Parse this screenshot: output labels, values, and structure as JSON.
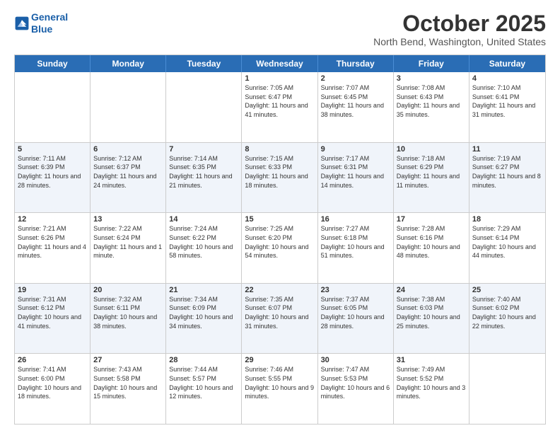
{
  "logo": {
    "line1": "General",
    "line2": "Blue"
  },
  "header": {
    "month": "October 2025",
    "location": "North Bend, Washington, United States"
  },
  "day_headers": [
    "Sunday",
    "Monday",
    "Tuesday",
    "Wednesday",
    "Thursday",
    "Friday",
    "Saturday"
  ],
  "weeks": [
    [
      {
        "date": "",
        "sunrise": "",
        "sunset": "",
        "daylight": ""
      },
      {
        "date": "",
        "sunrise": "",
        "sunset": "",
        "daylight": ""
      },
      {
        "date": "",
        "sunrise": "",
        "sunset": "",
        "daylight": ""
      },
      {
        "date": "1",
        "sunrise": "Sunrise: 7:05 AM",
        "sunset": "Sunset: 6:47 PM",
        "daylight": "Daylight: 11 hours and 41 minutes."
      },
      {
        "date": "2",
        "sunrise": "Sunrise: 7:07 AM",
        "sunset": "Sunset: 6:45 PM",
        "daylight": "Daylight: 11 hours and 38 minutes."
      },
      {
        "date": "3",
        "sunrise": "Sunrise: 7:08 AM",
        "sunset": "Sunset: 6:43 PM",
        "daylight": "Daylight: 11 hours and 35 minutes."
      },
      {
        "date": "4",
        "sunrise": "Sunrise: 7:10 AM",
        "sunset": "Sunset: 6:41 PM",
        "daylight": "Daylight: 11 hours and 31 minutes."
      }
    ],
    [
      {
        "date": "5",
        "sunrise": "Sunrise: 7:11 AM",
        "sunset": "Sunset: 6:39 PM",
        "daylight": "Daylight: 11 hours and 28 minutes."
      },
      {
        "date": "6",
        "sunrise": "Sunrise: 7:12 AM",
        "sunset": "Sunset: 6:37 PM",
        "daylight": "Daylight: 11 hours and 24 minutes."
      },
      {
        "date": "7",
        "sunrise": "Sunrise: 7:14 AM",
        "sunset": "Sunset: 6:35 PM",
        "daylight": "Daylight: 11 hours and 21 minutes."
      },
      {
        "date": "8",
        "sunrise": "Sunrise: 7:15 AM",
        "sunset": "Sunset: 6:33 PM",
        "daylight": "Daylight: 11 hours and 18 minutes."
      },
      {
        "date": "9",
        "sunrise": "Sunrise: 7:17 AM",
        "sunset": "Sunset: 6:31 PM",
        "daylight": "Daylight: 11 hours and 14 minutes."
      },
      {
        "date": "10",
        "sunrise": "Sunrise: 7:18 AM",
        "sunset": "Sunset: 6:29 PM",
        "daylight": "Daylight: 11 hours and 11 minutes."
      },
      {
        "date": "11",
        "sunrise": "Sunrise: 7:19 AM",
        "sunset": "Sunset: 6:27 PM",
        "daylight": "Daylight: 11 hours and 8 minutes."
      }
    ],
    [
      {
        "date": "12",
        "sunrise": "Sunrise: 7:21 AM",
        "sunset": "Sunset: 6:26 PM",
        "daylight": "Daylight: 11 hours and 4 minutes."
      },
      {
        "date": "13",
        "sunrise": "Sunrise: 7:22 AM",
        "sunset": "Sunset: 6:24 PM",
        "daylight": "Daylight: 11 hours and 1 minute."
      },
      {
        "date": "14",
        "sunrise": "Sunrise: 7:24 AM",
        "sunset": "Sunset: 6:22 PM",
        "daylight": "Daylight: 10 hours and 58 minutes."
      },
      {
        "date": "15",
        "sunrise": "Sunrise: 7:25 AM",
        "sunset": "Sunset: 6:20 PM",
        "daylight": "Daylight: 10 hours and 54 minutes."
      },
      {
        "date": "16",
        "sunrise": "Sunrise: 7:27 AM",
        "sunset": "Sunset: 6:18 PM",
        "daylight": "Daylight: 10 hours and 51 minutes."
      },
      {
        "date": "17",
        "sunrise": "Sunrise: 7:28 AM",
        "sunset": "Sunset: 6:16 PM",
        "daylight": "Daylight: 10 hours and 48 minutes."
      },
      {
        "date": "18",
        "sunrise": "Sunrise: 7:29 AM",
        "sunset": "Sunset: 6:14 PM",
        "daylight": "Daylight: 10 hours and 44 minutes."
      }
    ],
    [
      {
        "date": "19",
        "sunrise": "Sunrise: 7:31 AM",
        "sunset": "Sunset: 6:12 PM",
        "daylight": "Daylight: 10 hours and 41 minutes."
      },
      {
        "date": "20",
        "sunrise": "Sunrise: 7:32 AM",
        "sunset": "Sunset: 6:11 PM",
        "daylight": "Daylight: 10 hours and 38 minutes."
      },
      {
        "date": "21",
        "sunrise": "Sunrise: 7:34 AM",
        "sunset": "Sunset: 6:09 PM",
        "daylight": "Daylight: 10 hours and 34 minutes."
      },
      {
        "date": "22",
        "sunrise": "Sunrise: 7:35 AM",
        "sunset": "Sunset: 6:07 PM",
        "daylight": "Daylight: 10 hours and 31 minutes."
      },
      {
        "date": "23",
        "sunrise": "Sunrise: 7:37 AM",
        "sunset": "Sunset: 6:05 PM",
        "daylight": "Daylight: 10 hours and 28 minutes."
      },
      {
        "date": "24",
        "sunrise": "Sunrise: 7:38 AM",
        "sunset": "Sunset: 6:03 PM",
        "daylight": "Daylight: 10 hours and 25 minutes."
      },
      {
        "date": "25",
        "sunrise": "Sunrise: 7:40 AM",
        "sunset": "Sunset: 6:02 PM",
        "daylight": "Daylight: 10 hours and 22 minutes."
      }
    ],
    [
      {
        "date": "26",
        "sunrise": "Sunrise: 7:41 AM",
        "sunset": "Sunset: 6:00 PM",
        "daylight": "Daylight: 10 hours and 18 minutes."
      },
      {
        "date": "27",
        "sunrise": "Sunrise: 7:43 AM",
        "sunset": "Sunset: 5:58 PM",
        "daylight": "Daylight: 10 hours and 15 minutes."
      },
      {
        "date": "28",
        "sunrise": "Sunrise: 7:44 AM",
        "sunset": "Sunset: 5:57 PM",
        "daylight": "Daylight: 10 hours and 12 minutes."
      },
      {
        "date": "29",
        "sunrise": "Sunrise: 7:46 AM",
        "sunset": "Sunset: 5:55 PM",
        "daylight": "Daylight: 10 hours and 9 minutes."
      },
      {
        "date": "30",
        "sunrise": "Sunrise: 7:47 AM",
        "sunset": "Sunset: 5:53 PM",
        "daylight": "Daylight: 10 hours and 6 minutes."
      },
      {
        "date": "31",
        "sunrise": "Sunrise: 7:49 AM",
        "sunset": "Sunset: 5:52 PM",
        "daylight": "Daylight: 10 hours and 3 minutes."
      },
      {
        "date": "",
        "sunrise": "",
        "sunset": "",
        "daylight": ""
      }
    ]
  ]
}
